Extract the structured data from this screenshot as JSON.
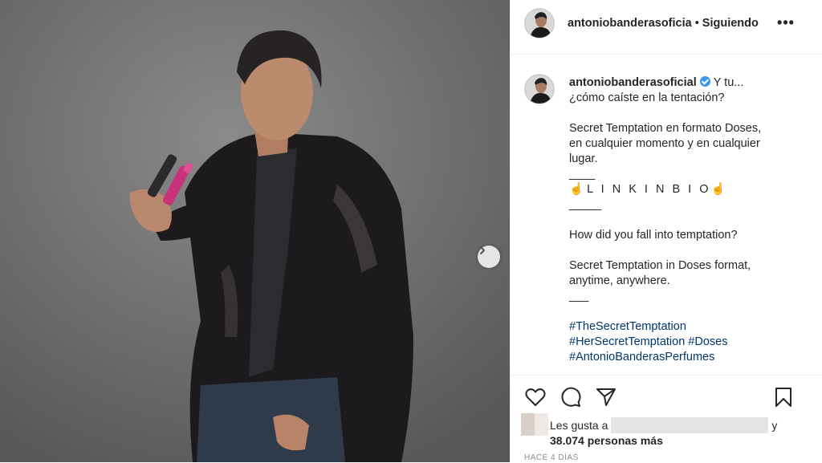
{
  "header": {
    "username": "antoniobanderasoficia",
    "separator": "•",
    "follow_status": "Siguiendo",
    "more_label": "•••"
  },
  "caption": {
    "username": "antoniobanderasoficial",
    "lines": [
      "Y tu...",
      "¿cómo caíste en la tentación?",
      "",
      "Secret Temptation en formato Doses,",
      "en cualquier momento y en cualquier",
      "lugar.",
      "____",
      "L I N K I N B I O",
      "_____",
      "",
      "How did you fall into temptation?",
      "",
      "Secret Temptation in Doses format,",
      "anytime, anywhere.",
      "___",
      ""
    ],
    "hashtags": [
      "#TheSecretTemptation",
      "#HerSecretTemptation #Doses",
      "#AntonioBanderasPerfumes"
    ]
  },
  "likes": {
    "prefix": "Les gusta a",
    "and": "y",
    "count": "38.074 personas más"
  },
  "timestamp": "HACE 4 DÍAS",
  "icons": {
    "like": "heart-icon",
    "comment": "comment-icon",
    "share": "share-icon",
    "save": "bookmark-icon",
    "next": "chevron-right-icon",
    "verified": "verified-badge-icon"
  },
  "colors": {
    "hashtag": "#00376b",
    "verified": "#3897f0",
    "text": "#262626",
    "muted": "#8e8e8e"
  }
}
